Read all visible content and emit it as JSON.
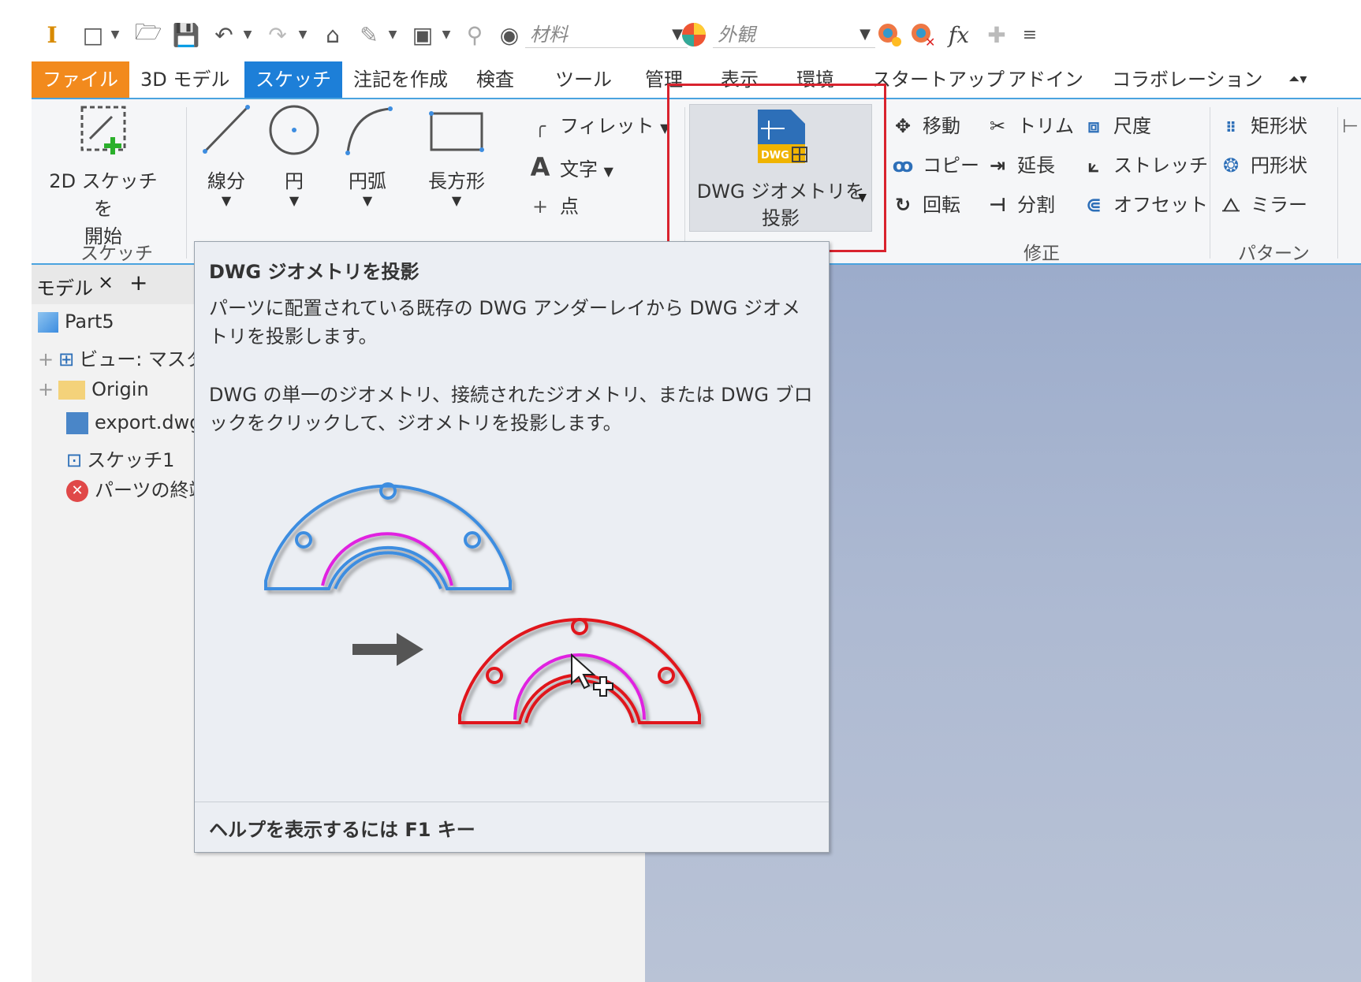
{
  "quick_access": {
    "material_placeholder": "材料",
    "appearance_placeholder": "外観",
    "fx_label": "fx"
  },
  "tabs": [
    {
      "label": "ファイル",
      "state": "file"
    },
    {
      "label": "3D モデル",
      "state": ""
    },
    {
      "label": "スケッチ",
      "state": "active"
    },
    {
      "label": "注記を作成",
      "state": ""
    },
    {
      "label": "検査",
      "state": ""
    },
    {
      "label": "ツール",
      "state": ""
    },
    {
      "label": "管理",
      "state": ""
    },
    {
      "label": "表示",
      "state": ""
    },
    {
      "label": "環境",
      "state": ""
    },
    {
      "label": "スタートアップ",
      "state": ""
    },
    {
      "label": "アドイン",
      "state": ""
    },
    {
      "label": "コラボレーション",
      "state": ""
    }
  ],
  "ribbon": {
    "start_sketch_line1": "2D スケッチを",
    "start_sketch_line2": "開始",
    "sketch_panel": "スケッチ",
    "line": "線分",
    "circle": "円",
    "arc": "円弧",
    "rectangle": "長方形",
    "fillet": "フィレット",
    "text": "文字",
    "point": "点",
    "dwg_line1": "DWG ジオメトリを",
    "dwg_line2": "投影",
    "move": "移動",
    "trim": "トリム",
    "dimension": "尺度",
    "copy": "コピー",
    "extend": "延長",
    "stretch": "ストレッチ",
    "rotate": "回転",
    "split": "分割",
    "offset": "オフセット",
    "modify_panel": "修正",
    "rect_pattern": "矩形状",
    "circ_pattern": "円形状",
    "mirror": "ミラー",
    "pattern_panel": "パターン"
  },
  "browser": {
    "tab_label": "モデル",
    "items": [
      {
        "label": "Part5"
      },
      {
        "label": "ビュー: マスタ"
      },
      {
        "label": "Origin"
      },
      {
        "label": "export.dwg"
      },
      {
        "label": "スケッチ1"
      },
      {
        "label": "パーツの終端"
      }
    ]
  },
  "tooltip": {
    "title": "DWG ジオメトリを投影",
    "para1": "パーツに配置されている既存の DWG アンダーレイから DWG ジオメトリを投影します。",
    "para2": "DWG の単一のジオメトリ、接続されたジオメトリ、または DWG ブロックをクリックして、ジオメトリを投影します。",
    "footer": "ヘルプを表示するには F1 キー"
  },
  "colors": {
    "file_tab": "#f28a1d",
    "active_tab": "#1d7fd8",
    "highlight": "#d9232e",
    "blue_part": "#3d8de0",
    "red_part": "#e0161e",
    "magenta": "#e020e0"
  }
}
